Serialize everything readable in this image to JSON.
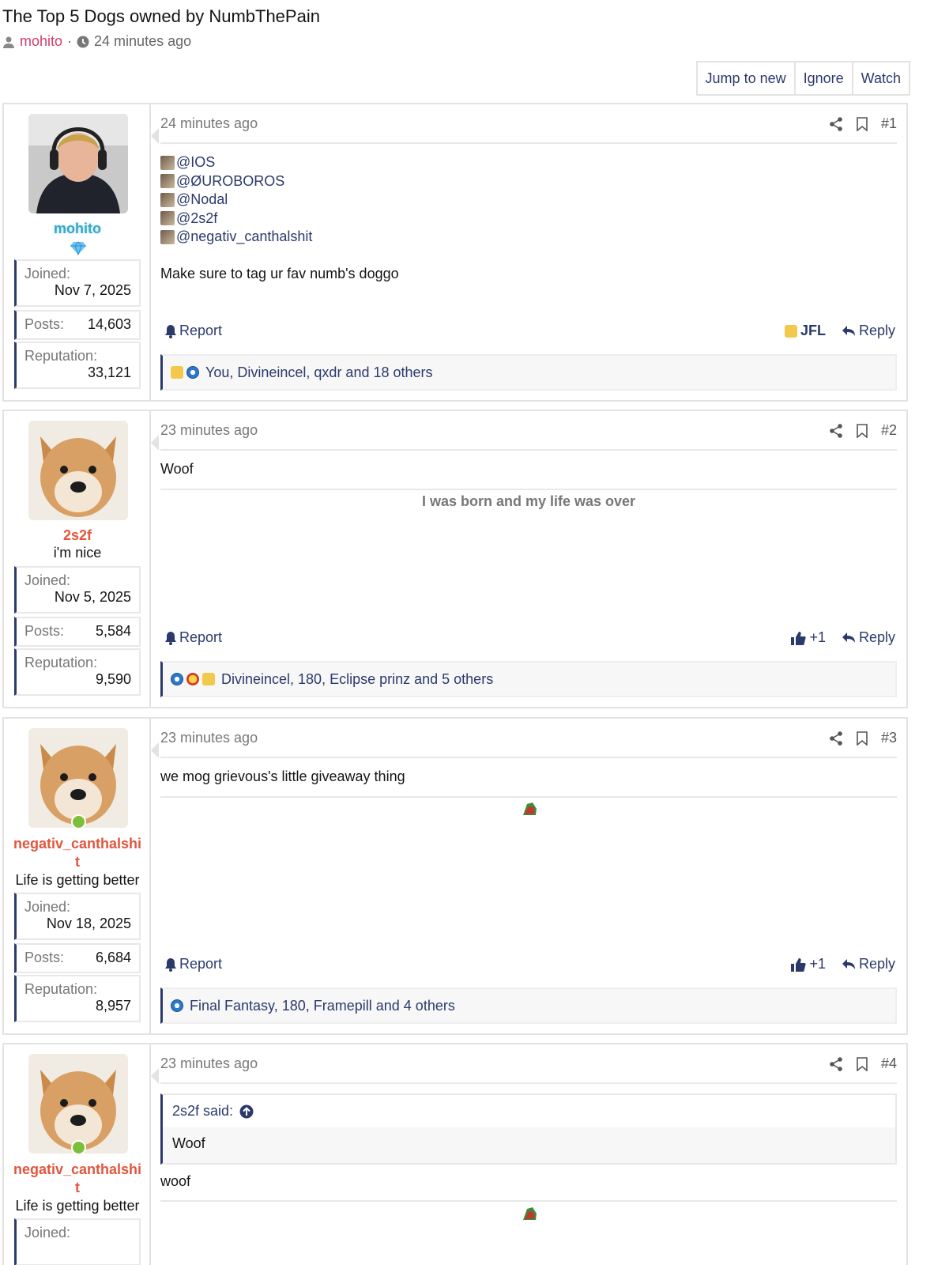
{
  "thread": {
    "title": "The Top 5 Dogs owned by NumbThePain",
    "author": "mohito",
    "separator": "·",
    "time": "24 minutes ago",
    "actions": [
      "Jump to new",
      "Ignore",
      "Watch"
    ]
  },
  "labels": {
    "joined": "Joined:",
    "posts": "Posts:",
    "reputation": "Reputation:",
    "report": "Report",
    "reply": "Reply"
  },
  "posts": [
    {
      "number": "#1",
      "time": "24 minutes ago",
      "user": {
        "name": "mohito",
        "title": "",
        "joined": "Nov 7, 2025",
        "posts": "14,603",
        "reputation": "33,121"
      },
      "mentions": [
        "@IOS",
        "@ØUROBOROS",
        "@Nodal",
        "@2s2f",
        "@negativ_canthalshit"
      ],
      "text": "Make sure to tag ur fav numb's doggo",
      "reaction_label": "JFL",
      "reactions_summary": "You, Divineincel, qxdr and 18 others"
    },
    {
      "number": "#2",
      "time": "23 minutes ago",
      "user": {
        "name": "2s2f",
        "title": "i'm nice",
        "joined": "Nov 5, 2025",
        "posts": "5,584",
        "reputation": "9,590"
      },
      "text": "Woof",
      "signature": "I was born and my life was over",
      "reaction_label": "+1",
      "reactions_summary": "Divineincel, 180, Eclipse prinz and 5 others"
    },
    {
      "number": "#3",
      "time": "23 minutes ago",
      "user": {
        "name": "negativ_canthalshit",
        "title": "Life is getting better",
        "joined": "Nov 18, 2025",
        "posts": "6,684",
        "reputation": "8,957"
      },
      "text": "we mog grievous's little giveaway thing",
      "reaction_label": "+1",
      "reactions_summary": "Final Fantasy, 180, Framepill and 4 others"
    },
    {
      "number": "#4",
      "time": "23 minutes ago",
      "user": {
        "name": "negativ_canthalshit",
        "title": "Life is getting better",
        "joined": ""
      },
      "quote_author": "2s2f said:",
      "quote_text": "Woof",
      "text": "woof"
    }
  ],
  "colors": {
    "link": "#2b3a6b",
    "username_red": "#e2553d",
    "username_blue": "#3aa7c7",
    "author_pink": "#d23d6a",
    "online": "#7bbf3a"
  },
  "icons": [
    "user-icon",
    "clock-icon",
    "share-icon",
    "bookmark-icon",
    "bell-icon",
    "reply-icon",
    "thumbs-up-icon",
    "gem-icon",
    "arrow-up-circle-icon"
  ]
}
